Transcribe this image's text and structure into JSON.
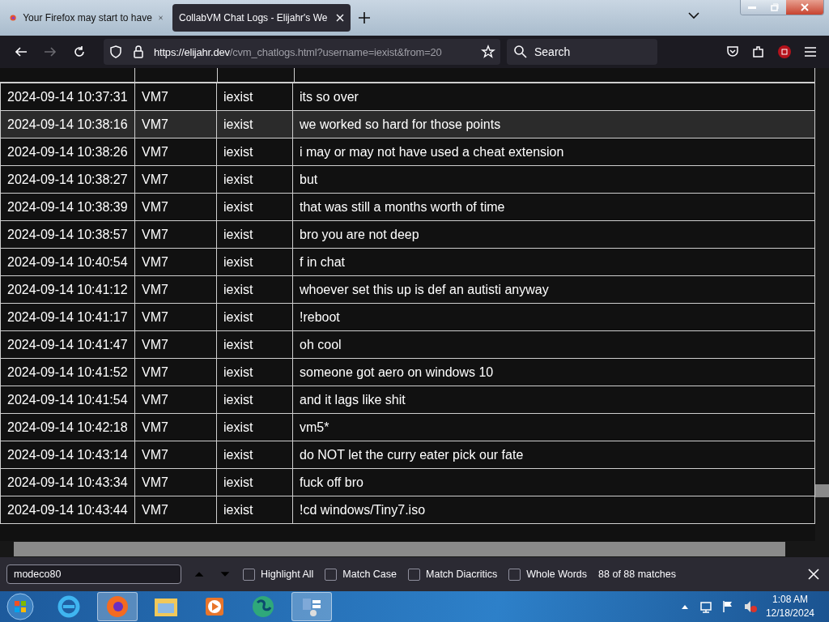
{
  "tabs": [
    {
      "title": "Your Firefox may start to have",
      "selected": false
    },
    {
      "title": "CollabVM Chat Logs - Elijahr's We",
      "selected": true
    }
  ],
  "toolbar": {
    "url_host": "https://elijahr.dev",
    "url_path": "/cvm_chatlogs.html?username=iexist&from=20",
    "search_placeholder": "Search"
  },
  "table": {
    "rows": [
      {
        "time": "2024-09-14 10:37:31",
        "vm": "VM7",
        "user": "iexist",
        "message": "its so over",
        "highlighted": false
      },
      {
        "time": "2024-09-14 10:38:16",
        "vm": "VM7",
        "user": "iexist",
        "message": "we worked so hard for those points",
        "highlighted": true
      },
      {
        "time": "2024-09-14 10:38:26",
        "vm": "VM7",
        "user": "iexist",
        "message": "i may or may not have used a cheat extension",
        "highlighted": false
      },
      {
        "time": "2024-09-14 10:38:27",
        "vm": "VM7",
        "user": "iexist",
        "message": "but",
        "highlighted": false
      },
      {
        "time": "2024-09-14 10:38:39",
        "vm": "VM7",
        "user": "iexist",
        "message": "that was still a months worth of time",
        "highlighted": false
      },
      {
        "time": "2024-09-14 10:38:57",
        "vm": "VM7",
        "user": "iexist",
        "message": "bro you are not deep",
        "highlighted": false
      },
      {
        "time": "2024-09-14 10:40:54",
        "vm": "VM7",
        "user": "iexist",
        "message": "f in chat",
        "highlighted": false
      },
      {
        "time": "2024-09-14 10:41:12",
        "vm": "VM7",
        "user": "iexist",
        "message": "whoever set this up is def an autisti anyway",
        "highlighted": false
      },
      {
        "time": "2024-09-14 10:41:17",
        "vm": "VM7",
        "user": "iexist",
        "message": "!reboot",
        "highlighted": false
      },
      {
        "time": "2024-09-14 10:41:47",
        "vm": "VM7",
        "user": "iexist",
        "message": "oh cool",
        "highlighted": false
      },
      {
        "time": "2024-09-14 10:41:52",
        "vm": "VM7",
        "user": "iexist",
        "message": "someone got aero on windows 10",
        "highlighted": false
      },
      {
        "time": "2024-09-14 10:41:54",
        "vm": "VM7",
        "user": "iexist",
        "message": "and it lags like shit",
        "highlighted": false
      },
      {
        "time": "2024-09-14 10:42:18",
        "vm": "VM7",
        "user": "iexist",
        "message": "vm5*",
        "highlighted": false
      },
      {
        "time": "2024-09-14 10:43:14",
        "vm": "VM7",
        "user": "iexist",
        "message": "do NOT let the curry eater pick our fate",
        "highlighted": false
      },
      {
        "time": "2024-09-14 10:43:34",
        "vm": "VM7",
        "user": "iexist",
        "message": "fuck off bro",
        "highlighted": false
      },
      {
        "time": "2024-09-14 10:43:44",
        "vm": "VM7",
        "user": "iexist",
        "message": "!cd windows/Tiny7.iso",
        "highlighted": false
      }
    ]
  },
  "find_bar": {
    "value": "modeco80",
    "options": [
      {
        "label": "Highlight All",
        "checked": false
      },
      {
        "label": "Match Case",
        "checked": false
      },
      {
        "label": "Match Diacritics",
        "checked": false
      },
      {
        "label": "Whole Words",
        "checked": false
      }
    ],
    "status": "88 of 88 matches"
  },
  "taskbar": {
    "time": "1:08 AM",
    "date": "12/18/2024"
  }
}
